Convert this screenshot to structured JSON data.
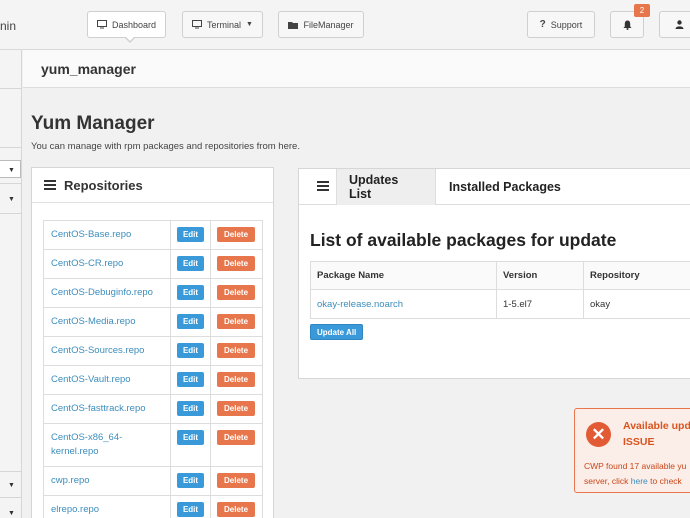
{
  "nav": {
    "brand_fragment": "nin",
    "dashboard": "Dashboard",
    "terminal": "Terminal",
    "filemanager": "FileManager",
    "support": "Support",
    "notification_count": "2"
  },
  "page": {
    "header": "yum_manager",
    "title": "Yum Manager",
    "description": "You can manage with rpm packages and repositories from here."
  },
  "repositories": {
    "title": "Repositories",
    "edit_label": "Edit",
    "delete_label": "Delete",
    "items": [
      "CentOS-Base.repo",
      "CentOS-CR.repo",
      "CentOS-Debuginfo.repo",
      "CentOS-Media.repo",
      "CentOS-Sources.repo",
      "CentOS-Vault.repo",
      "CentOS-fasttrack.repo",
      "CentOS-x86_64-kernel.repo",
      "cwp.repo",
      "elrepo.repo"
    ]
  },
  "updates": {
    "tabs": [
      "Updates List",
      "Installed Packages"
    ],
    "title": "List of available packages for update",
    "columns": [
      "Package Name",
      "Version",
      "Repository"
    ],
    "rows": [
      {
        "name": "okay-release.noarch",
        "version": "1-5.el7",
        "repo": "okay"
      }
    ],
    "update_all": "Update All"
  },
  "alert": {
    "title": "Available upd",
    "title2": "ISSUE",
    "body1": "CWP found 17 available yu",
    "body2_pre": "server, click ",
    "body2_link": "here",
    "body2_post": " to check"
  },
  "colors": {
    "link": "#3c8dbc",
    "edit_button": "#3a9ad9",
    "delete_button": "#e8764c",
    "alert_red": "#e25b34"
  }
}
